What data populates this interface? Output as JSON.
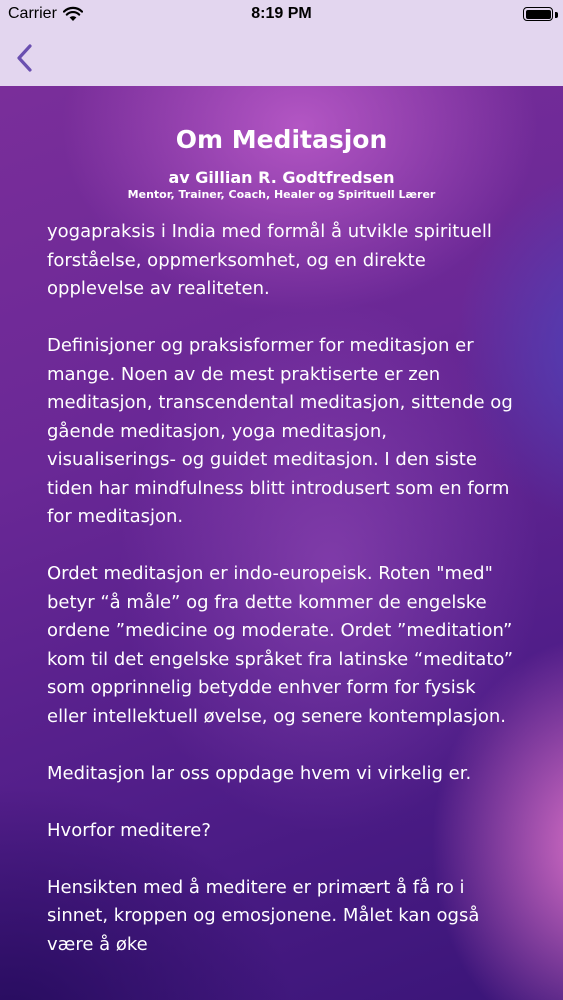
{
  "status_bar": {
    "carrier": "Carrier",
    "time": "8:19 PM"
  },
  "nav": {
    "back_icon": "chevron-left-icon",
    "accent_color": "#6a4fb0"
  },
  "article": {
    "title": "Om Meditasjon",
    "author": "av Gillian R. Godtfredsen",
    "roles": "Mentor, Trainer, Coach, Healer og Spirituell Lærer",
    "paragraphs": [
      "yogapraksis i India med formål å utvikle spirituell forståelse, oppmerksomhet, og en direkte opplevelse av realiteten.",
      "Definisjoner og praksisformer for meditasjon er mange. Noen av de mest praktiserte er zen meditasjon, transcendental meditasjon, sittende og gående meditasjon, yoga meditasjon, visualiserings- og guidet meditasjon. I den siste tiden har mindfulness blitt introdusert som en form for meditasjon.",
      "Ordet meditasjon er indo-europeisk. Roten \"med\" betyr “å måle” og fra dette kommer de engelske ordene ”medicine og moderate. Ordet ”meditation” kom til det engelske språket fra latinske “meditato” som opprinnelig betydde enhver form for fysisk eller intellektuell øvelse, og senere kontemplasjon.",
      "Meditasjon lar oss oppdage hvem vi virkelig er.",
      "Hvorfor meditere?",
      "Hensikten med å meditere er primært å få ro i sinnet, kroppen og emosjonene. Målet kan også være å øke"
    ]
  }
}
